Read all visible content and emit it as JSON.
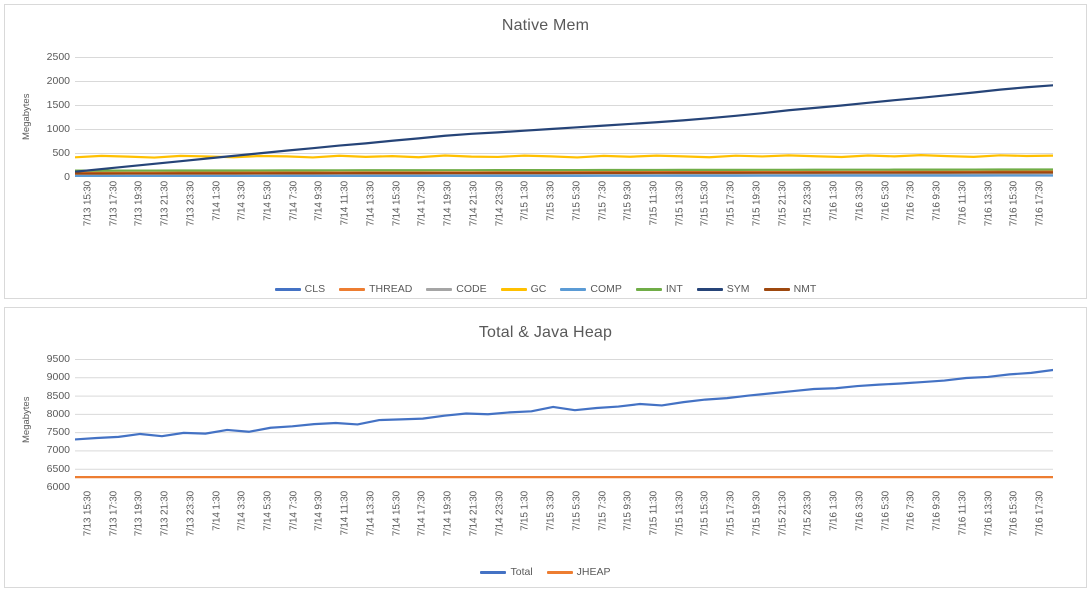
{
  "colors": {
    "CLS": "#4472C4",
    "THREAD": "#ED7D31",
    "CODE": "#A5A5A5",
    "GC": "#FFC000",
    "COMP": "#5B9BD5",
    "INT": "#70AD47",
    "SYM": "#264478",
    "NMT": "#9E480E",
    "Total": "#4472C4",
    "JHEAP": "#ED7D31",
    "grid": "#d9d9d9",
    "text": "#595959",
    "panel_border": "#d9d9d9"
  },
  "charts": [
    {
      "id": "native-mem",
      "title": "Native Mem",
      "ylabel": "Megabytes"
    },
    {
      "id": "total-java-heap",
      "title": "Total & Java Heap",
      "ylabel": "Megabytes"
    }
  ],
  "chart_data": [
    {
      "type": "line",
      "title": "Native Mem",
      "xlabel": "",
      "ylabel": "Megabytes",
      "ylim": [
        0,
        2500
      ],
      "yticks": [
        0,
        500,
        1000,
        1500,
        2000,
        2500
      ],
      "grid": true,
      "legend_position": "bottom",
      "categories": [
        "7/13 15:30",
        "7/13 17:30",
        "7/13 19:30",
        "7/13 21:30",
        "7/13 23:30",
        "7/14 1:30",
        "7/14 3:30",
        "7/14 5:30",
        "7/14 7:30",
        "7/14 9:30",
        "7/14 11:30",
        "7/14 13:30",
        "7/14 15:30",
        "7/14 17:30",
        "7/14 19:30",
        "7/14 21:30",
        "7/14 23:30",
        "7/15 1:30",
        "7/15 3:30",
        "7/15 5:30",
        "7/15 7:30",
        "7/15 9:30",
        "7/15 11:30",
        "7/15 13:30",
        "7/15 15:30",
        "7/15 17:30",
        "7/15 19:30",
        "7/15 21:30",
        "7/15 23:30",
        "7/16 1:30",
        "7/16 3:30",
        "7/16 5:30",
        "7/16 7:30",
        "7/16 9:30",
        "7/16 11:30",
        "7/16 13:30",
        "7/16 15:30",
        "7/16 17:30"
      ],
      "series": [
        {
          "name": "CLS",
          "color": "#4472C4",
          "values": [
            62,
            63,
            64,
            64,
            65,
            66,
            66,
            67,
            68,
            68,
            69,
            70,
            70,
            71,
            72,
            72,
            73,
            74,
            74,
            75,
            76,
            76,
            77,
            78,
            78,
            79,
            80,
            80,
            81,
            82,
            82,
            83,
            84,
            84,
            85,
            86,
            86,
            87
          ]
        },
        {
          "name": "THREAD",
          "color": "#ED7D31",
          "values": [
            88,
            89,
            90,
            90,
            91,
            92,
            92,
            93,
            94,
            94,
            95,
            96,
            96,
            97,
            98,
            98,
            99,
            100,
            100,
            101,
            102,
            102,
            103,
            104,
            104,
            105,
            106,
            106,
            107,
            108,
            108,
            109,
            110,
            110,
            111,
            112,
            112,
            113
          ]
        },
        {
          "name": "CODE",
          "color": "#A5A5A5",
          "values": [
            52,
            53,
            54,
            54,
            55,
            56,
            56,
            57,
            58,
            58,
            59,
            60,
            60,
            61,
            62,
            62,
            63,
            64,
            64,
            65,
            66,
            66,
            67,
            68,
            68,
            69,
            70,
            70,
            71,
            72,
            72,
            73,
            74,
            74,
            75,
            76,
            76,
            77
          ]
        },
        {
          "name": "GC",
          "color": "#FFC000",
          "values": [
            410,
            440,
            425,
            405,
            440,
            428,
            412,
            438,
            430,
            408,
            442,
            420,
            435,
            412,
            448,
            425,
            418,
            445,
            430,
            408,
            440,
            422,
            446,
            430,
            412,
            444,
            428,
            450,
            432,
            416,
            448,
            430,
            455,
            435,
            420,
            452,
            438,
            445
          ]
        },
        {
          "name": "COMP",
          "color": "#5B9BD5",
          "values": [
            18,
            18,
            19,
            19,
            19,
            20,
            20,
            20,
            21,
            21,
            21,
            22,
            22,
            22,
            23,
            23,
            23,
            24,
            24,
            24,
            25,
            25,
            25,
            26,
            26,
            26,
            27,
            27,
            27,
            28,
            28,
            28,
            29,
            29,
            29,
            30,
            30,
            30
          ]
        },
        {
          "name": "INT",
          "color": "#70AD47",
          "values": [
            132,
            133,
            134,
            134,
            135,
            136,
            136,
            137,
            138,
            138,
            139,
            140,
            140,
            141,
            142,
            142,
            143,
            144,
            144,
            145,
            146,
            146,
            147,
            148,
            148,
            149,
            150,
            150,
            151,
            152,
            152,
            153,
            154,
            154,
            155,
            156,
            156,
            157
          ]
        },
        {
          "name": "SYM",
          "color": "#264478",
          "values": [
            110,
            165,
            220,
            275,
            330,
            385,
            440,
            495,
            550,
            600,
            655,
            700,
            755,
            805,
            860,
            900,
            930,
            965,
            1000,
            1035,
            1070,
            1105,
            1140,
            1180,
            1225,
            1275,
            1330,
            1390,
            1440,
            1490,
            1545,
            1600,
            1650,
            1705,
            1760,
            1820,
            1870,
            1910
          ]
        },
        {
          "name": "NMT",
          "color": "#9E480E",
          "values": [
            72,
            73,
            74,
            74,
            75,
            76,
            76,
            77,
            78,
            78,
            79,
            80,
            80,
            81,
            82,
            82,
            83,
            84,
            84,
            85,
            86,
            86,
            87,
            88,
            88,
            89,
            90,
            90,
            91,
            92,
            92,
            93,
            94,
            94,
            95,
            96,
            96,
            97
          ]
        }
      ],
      "legend": [
        {
          "label": "CLS",
          "color": "#4472C4"
        },
        {
          "label": "THREAD",
          "color": "#ED7D31"
        },
        {
          "label": "CODE",
          "color": "#A5A5A5"
        },
        {
          "label": "GC",
          "color": "#FFC000"
        },
        {
          "label": "COMP",
          "color": "#5B9BD5"
        },
        {
          "label": "INT",
          "color": "#70AD47"
        },
        {
          "label": "SYM",
          "color": "#264478"
        },
        {
          "label": "NMT",
          "color": "#9E480E"
        }
      ]
    },
    {
      "type": "line",
      "title": "Total & Java Heap",
      "xlabel": "",
      "ylabel": "Megabytes",
      "ylim": [
        6000,
        9500
      ],
      "yticks": [
        6000,
        6500,
        7000,
        7500,
        8000,
        8500,
        9000,
        9500
      ],
      "grid": true,
      "legend_position": "bottom",
      "categories": [
        "7/13 15:30",
        "7/13 17:30",
        "7/13 19:30",
        "7/13 21:30",
        "7/13 23:30",
        "7/14 1:30",
        "7/14 3:30",
        "7/14 5:30",
        "7/14 7:30",
        "7/14 9:30",
        "7/14 11:30",
        "7/14 13:30",
        "7/14 15:30",
        "7/14 17:30",
        "7/14 19:30",
        "7/14 21:30",
        "7/14 23:30",
        "7/15 1:30",
        "7/15 3:30",
        "7/15 5:30",
        "7/15 7:30",
        "7/15 9:30",
        "7/15 11:30",
        "7/15 13:30",
        "7/15 15:30",
        "7/15 17:30",
        "7/15 19:30",
        "7/15 21:30",
        "7/15 23:30",
        "7/16 1:30",
        "7/16 3:30",
        "7/16 5:30",
        "7/16 7:30",
        "7/16 9:30",
        "7/16 11:30",
        "7/16 13:30",
        "7/16 15:30",
        "7/16 17:30"
      ],
      "series": [
        {
          "name": "Total",
          "color": "#4472C4",
          "values": [
            7300,
            7340,
            7370,
            7450,
            7390,
            7480,
            7460,
            7560,
            7510,
            7620,
            7660,
            7720,
            7750,
            7710,
            7830,
            7850,
            7870,
            7950,
            8010,
            7990,
            8040,
            8070,
            8190,
            8100,
            8160,
            8200,
            8270,
            8230,
            8320,
            8390,
            8430,
            8500,
            8560,
            8620,
            8680,
            8700,
            8760,
            8800,
            8830,
            8870,
            8910,
            8980,
            9010,
            9080,
            9120,
            9200
          ]
        },
        {
          "name": "JHEAP",
          "color": "#ED7D31",
          "values": [
            6270,
            6270,
            6270,
            6270,
            6270,
            6270,
            6270,
            6270,
            6270,
            6270,
            6270,
            6270,
            6270,
            6270,
            6270,
            6270,
            6270,
            6270,
            6270,
            6270,
            6270,
            6270,
            6270,
            6270,
            6270,
            6270,
            6270,
            6270,
            6270,
            6270,
            6270,
            6270,
            6270,
            6270,
            6270,
            6270,
            6270,
            6270
          ]
        }
      ],
      "legend": [
        {
          "label": "Total",
          "color": "#4472C4"
        },
        {
          "label": "JHEAP",
          "color": "#ED7D31"
        }
      ]
    }
  ]
}
